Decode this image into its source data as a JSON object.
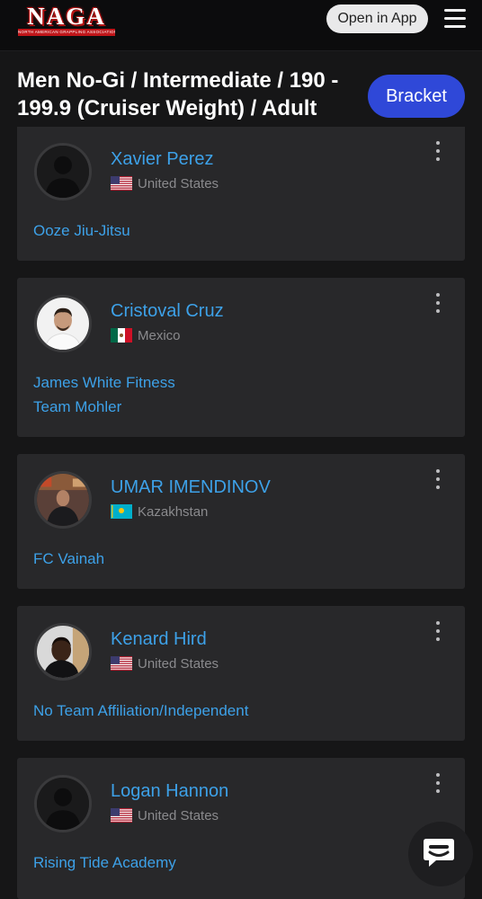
{
  "header": {
    "logo_text": "NAGA",
    "logo_subtext": "NORTH AMERICAN GRAPPLING ASSOCIATION",
    "open_in_app_label": "Open in App",
    "menu_icon": "hamburger-menu-icon"
  },
  "division": {
    "title": "Men No-Gi / Intermediate / 190 - 199.9 (Cruiser Weight) / Adult",
    "bracket_label": "Bracket"
  },
  "athletes": [
    {
      "name": "Xavier Perez",
      "country": "United States",
      "flag": "us-flag-icon",
      "teams": [
        "Ooze Jiu-Jitsu"
      ],
      "avatar": "default-avatar"
    },
    {
      "name": "Cristoval Cruz",
      "country": "Mexico",
      "flag": "mexico-flag-icon",
      "teams": [
        "James White Fitness",
        "Team Mohler"
      ],
      "avatar": "photo"
    },
    {
      "name": "UMAR IMENDINOV",
      "country": "Kazakhstan",
      "flag": "kazakhstan-flag-icon",
      "teams": [
        "FC Vainah"
      ],
      "avatar": "photo"
    },
    {
      "name": "Kenard Hird",
      "country": "United States",
      "flag": "us-flag-icon",
      "teams": [
        "No Team Affiliation/Independent"
      ],
      "avatar": "photo"
    },
    {
      "name": "Logan Hannon",
      "country": "United States",
      "flag": "us-flag-icon",
      "teams": [
        "Rising Tide Academy"
      ],
      "avatar": "default-avatar"
    }
  ],
  "chat": {
    "icon": "chat-icon"
  },
  "colors": {
    "background": "#161617",
    "card": "#28282a",
    "link": "#3da1e8",
    "bracket_button": "#2f48d8",
    "brand_red": "#c0161a"
  }
}
